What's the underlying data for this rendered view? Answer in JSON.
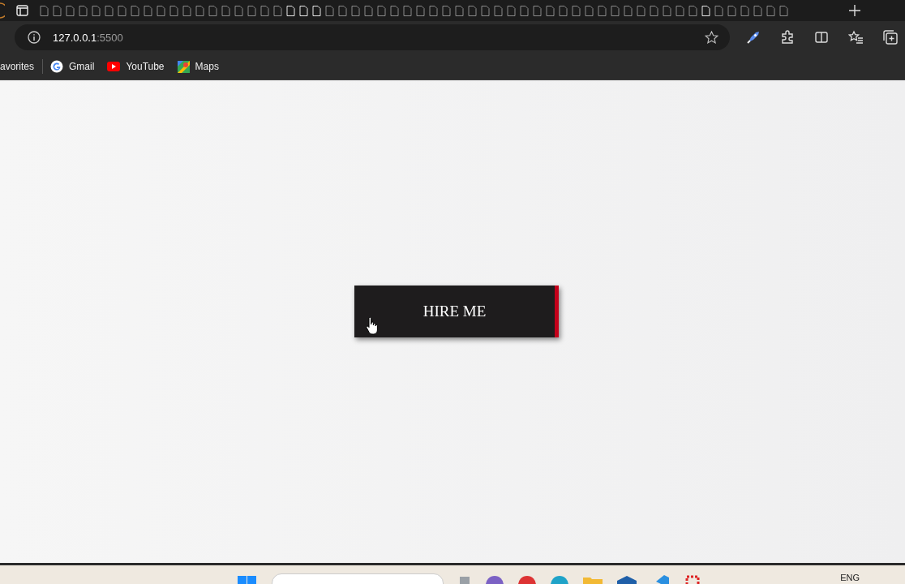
{
  "address_bar": {
    "host": "127.0.0.1",
    "port": ":5500"
  },
  "bookmarks": [
    {
      "label": "avorites",
      "kind": "folder"
    },
    {
      "label": "Gmail",
      "kind": "google"
    },
    {
      "label": "YouTube",
      "kind": "youtube"
    },
    {
      "label": "Maps",
      "kind": "maps"
    }
  ],
  "page": {
    "button": "HIRE ME"
  },
  "taskbar": {
    "language": "ENG"
  }
}
